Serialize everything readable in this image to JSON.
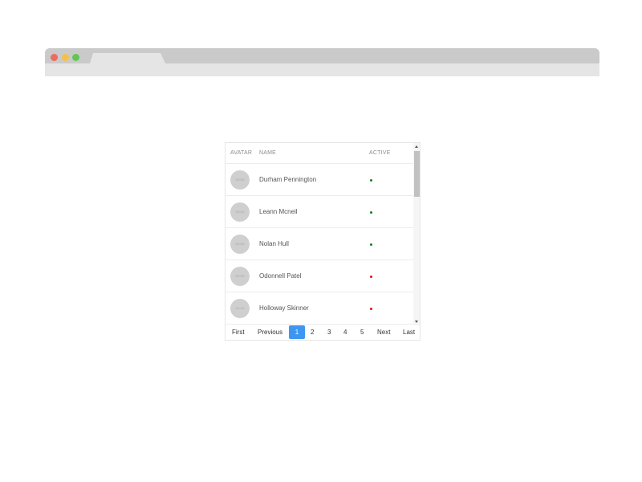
{
  "browser": {
    "controls": [
      "close",
      "minimize",
      "maximize"
    ],
    "tab_title": ""
  },
  "grid": {
    "columns": {
      "avatar": "AVATAR",
      "name": "NAME",
      "active": "ACTIVE"
    },
    "rows": [
      {
        "avatar_text": "32×32",
        "name": "Durham Pennington",
        "active": true,
        "status_color": "#1a7f1a"
      },
      {
        "avatar_text": "32×32",
        "name": "Leann Mcneil",
        "active": true,
        "status_color": "#1a7f1a"
      },
      {
        "avatar_text": "32×32",
        "name": "Nolan Hull",
        "active": true,
        "status_color": "#1a7f1a"
      },
      {
        "avatar_text": "32×32",
        "name": "Odonnell Patel",
        "active": false,
        "status_color": "#e01010"
      },
      {
        "avatar_text": "32×32",
        "name": "Holloway Skinner",
        "active": false,
        "status_color": "#e01010"
      }
    ]
  },
  "pagination": {
    "first": "First",
    "previous": "Previous",
    "pages": [
      "1",
      "2",
      "3",
      "4",
      "5"
    ],
    "current_page": "1",
    "next": "Next",
    "last": "Last"
  },
  "colors": {
    "accent": "#3d97f2",
    "active_status": "#1a7f1a",
    "inactive_status": "#e01010"
  },
  "icons": {
    "browser_close": "close-dot-icon",
    "browser_minimize": "minimize-dot-icon",
    "browser_maximize": "maximize-dot-icon",
    "scroll_up": "up-arrow-icon",
    "scroll_down": "down-arrow-icon",
    "status": "status-dot-icon"
  }
}
